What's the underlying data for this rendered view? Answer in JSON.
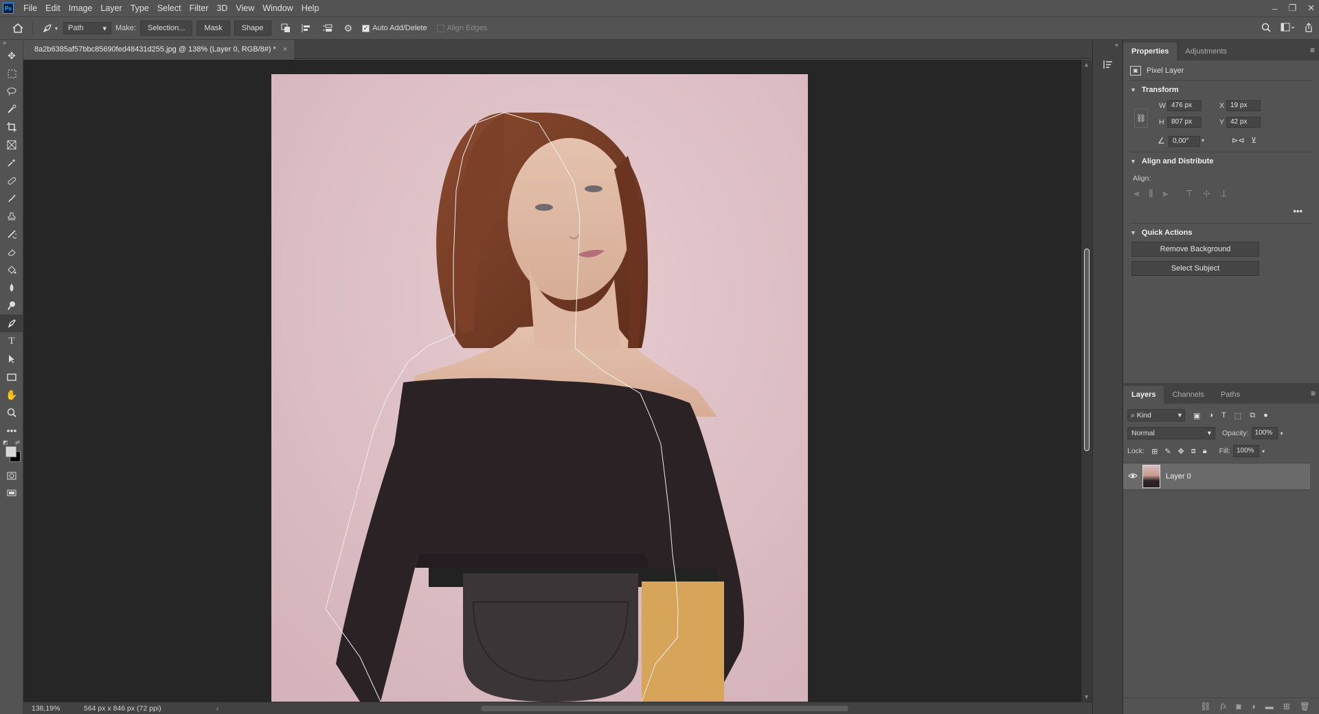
{
  "app": {
    "logo": "Ps"
  },
  "menu": [
    "File",
    "Edit",
    "Image",
    "Layer",
    "Type",
    "Select",
    "Filter",
    "3D",
    "View",
    "Window",
    "Help"
  ],
  "window_controls": {
    "minimize": "–",
    "restore": "❐",
    "close": "✕"
  },
  "options": {
    "mode": "Path",
    "make_label": "Make:",
    "selection_button": "Selection...",
    "mask_button": "Mask",
    "shape_button": "Shape",
    "auto_add_delete": "Auto Add/Delete",
    "auto_add_delete_checked": true,
    "align_edges": "Align Edges",
    "align_edges_checked": false
  },
  "document": {
    "tab_title": "8a2b6385af57bbc85690fed48431d255.jpg @ 138% (Layer 0, RGB/8#) *",
    "close": "×"
  },
  "status": {
    "zoom": "138,19%",
    "doc_info": "564 px x 846 px (72 ppi)",
    "arrow": "›"
  },
  "properties": {
    "tabs": [
      "Properties",
      "Adjustments"
    ],
    "layer_type": "Pixel Layer",
    "transform": {
      "title": "Transform",
      "w_label": "W",
      "w": "476 px",
      "h_label": "H",
      "h": "807 px",
      "x_label": "X",
      "x": "19 px",
      "y_label": "Y",
      "y": "42 px",
      "angle": "0,00°"
    },
    "align": {
      "title": "Align and Distribute",
      "label": "Align:"
    },
    "quick_actions": {
      "title": "Quick Actions",
      "remove_bg": "Remove Background",
      "select_subject": "Select Subject"
    }
  },
  "layers": {
    "tabs": [
      "Layers",
      "Channels",
      "Paths"
    ],
    "kind": "Kind",
    "blend_mode": "Normal",
    "opacity_label": "Opacity:",
    "opacity": "100%",
    "lock_label": "Lock:",
    "fill_label": "Fill:",
    "fill": "100%",
    "items": [
      {
        "name": "Layer 0",
        "visible": true
      }
    ]
  },
  "colors": {
    "accent": "#31a8ff",
    "panel_bg": "#535353",
    "canvas_bg": "#262626",
    "photo_bg": "#dcc0c6",
    "top_color": "#2b2226",
    "path_color": "#e8e8e8"
  }
}
